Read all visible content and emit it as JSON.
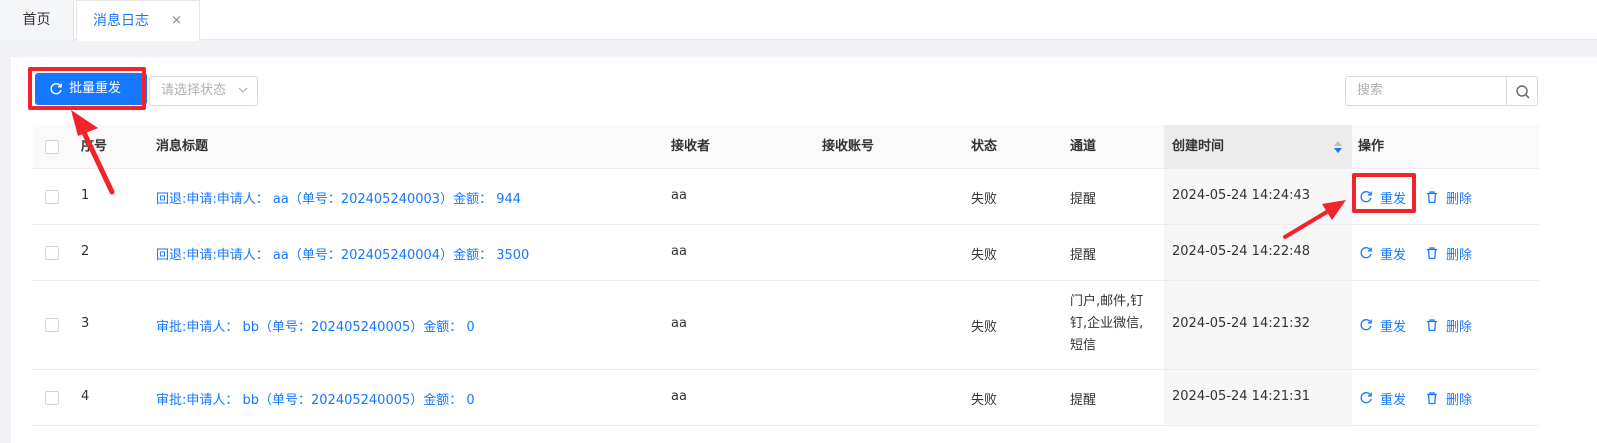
{
  "tabs": [
    {
      "label": "首页"
    },
    {
      "label": "消息日志",
      "close": "×"
    }
  ],
  "toolbar": {
    "batch_resend_label": "批量重发",
    "status_placeholder": "请选择状态",
    "search_placeholder": "搜索"
  },
  "table": {
    "columns": [
      "序号",
      "消息标题",
      "接收者",
      "接收账号",
      "状态",
      "通道",
      "创建时间",
      "操作"
    ],
    "rows": [
      {
        "index": "1",
        "title": "回退:申请:申请人： aa（单号：202405240003）金额： 944",
        "receiver": "aa",
        "account": "",
        "status": "失败",
        "channel": "提醒",
        "created": "2024-05-24 14:24:43"
      },
      {
        "index": "2",
        "title": "回退:申请:申请人： aa（单号：202405240004）金额： 3500",
        "receiver": "aa",
        "account": "",
        "status": "失败",
        "channel": "提醒",
        "created": "2024-05-24 14:22:48"
      },
      {
        "index": "3",
        "title": "审批:申请人： bb（单号：202405240005）金额： 0",
        "receiver": "aa",
        "account": "",
        "status": "失败",
        "channel_lines": [
          "门户,邮件,钉",
          "钉,企业微信,",
          "短信"
        ],
        "created": "2024-05-24 14:21:32"
      },
      {
        "index": "4",
        "title": "审批:申请人： bb（单号：202405240005）金额： 0",
        "receiver": "aa",
        "account": "",
        "status": "失败",
        "channel": "提醒",
        "created": "2024-05-24 14:21:31"
      }
    ],
    "actions": {
      "resend": "重发",
      "delete": "删除"
    }
  },
  "colors": {
    "accent": "#1677ff",
    "highlight": "#f2232a"
  }
}
